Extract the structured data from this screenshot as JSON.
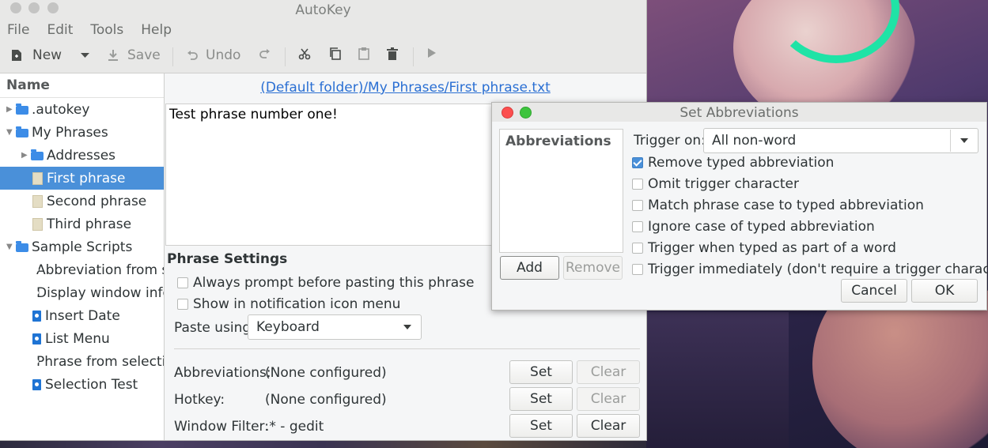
{
  "window": {
    "title": "AutoKey"
  },
  "menu": [
    "File",
    "Edit",
    "Tools",
    "Help"
  ],
  "toolbar": {
    "new": "New",
    "save": "Save",
    "undo": "Undo"
  },
  "tree": {
    "header": "Name",
    "items": [
      {
        "label": ".autokey",
        "kind": "folder",
        "expander": "collapsed"
      },
      {
        "label": "My Phrases",
        "kind": "folder",
        "expander": "expanded"
      },
      {
        "label": "Addresses",
        "kind": "folder",
        "expander": "collapsed"
      },
      {
        "label": "First phrase",
        "kind": "phrase",
        "selected": true
      },
      {
        "label": "Second phrase",
        "kind": "phrase"
      },
      {
        "label": "Third phrase",
        "kind": "phrase"
      },
      {
        "label": "Sample Scripts",
        "kind": "folder",
        "expander": "expanded"
      },
      {
        "label": "Abbreviation from s",
        "kind": "script"
      },
      {
        "label": "Display window info",
        "kind": "script"
      },
      {
        "label": "Insert Date",
        "kind": "script"
      },
      {
        "label": "List Menu",
        "kind": "script"
      },
      {
        "label": "Phrase from selectio",
        "kind": "script"
      },
      {
        "label": "Selection Test",
        "kind": "script"
      }
    ]
  },
  "editor": {
    "path": "(Default folder)/My Phrases/First phrase.txt",
    "content": "Test phrase number one!"
  },
  "phrase_settings": {
    "title": "Phrase Settings",
    "always_prompt": "Always prompt before pasting this phrase",
    "show_in_tray": "Show in notification icon menu",
    "paste_using_label": "Paste using",
    "paste_using_value": "Keyboard",
    "abbreviations_label": "Abbreviations:",
    "abbreviations_value": "(None configured)",
    "hotkey_label": "Hotkey:",
    "hotkey_value": "(None configured)",
    "window_filter_label": "Window Filter:",
    "window_filter_value": ".* - gedit",
    "set": "Set",
    "clear": "Clear"
  },
  "dialog": {
    "title": "Set Abbreviations",
    "list_header": "Abbreviations",
    "add": "Add",
    "remove": "Remove",
    "trigger_label": "Trigger on:",
    "trigger_value": "All non-word",
    "options": [
      {
        "label": "Remove typed abbreviation",
        "checked": true
      },
      {
        "label": "Omit trigger character",
        "checked": false
      },
      {
        "label": "Match phrase case to typed abbreviation",
        "checked": false
      },
      {
        "label": "Ignore case of typed abbreviation",
        "checked": false
      },
      {
        "label": "Trigger when typed as part of a word",
        "checked": false
      },
      {
        "label": "Trigger immediately (don't require a trigger character)",
        "checked": false
      }
    ],
    "cancel": "Cancel",
    "ok": "OK"
  },
  "colors": {
    "accent": "#4a90d9",
    "link": "#2a6fd3",
    "close": "#fc4f4f",
    "maximize": "#3ec43e"
  }
}
